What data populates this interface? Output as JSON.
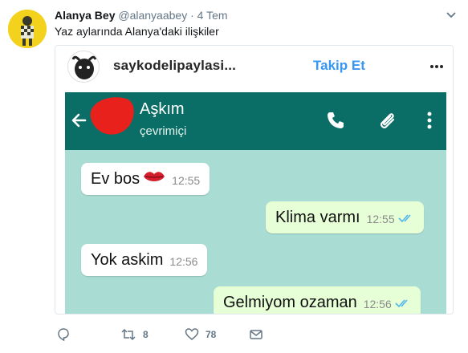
{
  "tweet": {
    "author_name": "Alanya Bey",
    "author_handle": "@alanyaabey",
    "separator": "·",
    "time": "4 Tem",
    "text": "Yaz aylarında Alanya'daki ilişkiler"
  },
  "embed": {
    "username": "saykodelipaylasi...",
    "follow_label": "Takip Et",
    "chat": {
      "contact_name": "Aşkım",
      "contact_status": "çevrimiçi",
      "messages": [
        {
          "text": "Ev bos",
          "time": "12:55",
          "direction": "incoming",
          "emoji": "lips"
        },
        {
          "text": "Klima varmı",
          "time": "12:55",
          "direction": "outgoing",
          "read": true
        },
        {
          "text": "Yok askim",
          "time": "12:56",
          "direction": "incoming"
        },
        {
          "text": "Gelmiyom ozaman",
          "time": "12:56",
          "direction": "outgoing",
          "read": true
        }
      ]
    }
  },
  "actions": {
    "reply_count": "",
    "retweet_count": "8",
    "like_count": "78"
  },
  "icons": [
    "caret-down-icon",
    "more-icon",
    "back-arrow-icon",
    "phone-icon",
    "attach-icon",
    "menu-dots-icon",
    "reply-icon",
    "retweet-icon",
    "like-icon",
    "dm-icon",
    "read-ticks-icon",
    "lips-emoji-icon"
  ],
  "colors": {
    "twitter_gray": "#657786",
    "instagram_blue": "#3897f0",
    "whatsapp_header": "#0b6e66",
    "whatsapp_bg": "#a9dcd3",
    "outgoing_bubble": "#e7ffd7",
    "read_ticks": "#4fb6ec"
  }
}
